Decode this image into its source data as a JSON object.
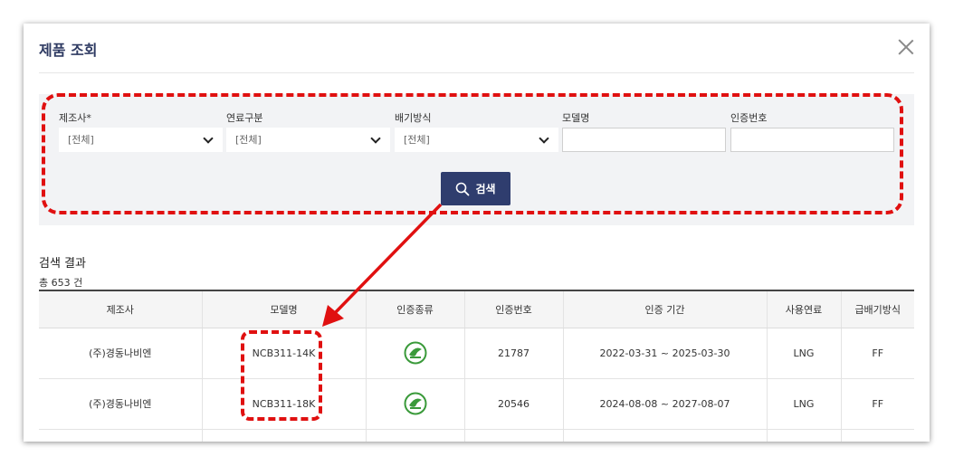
{
  "dialog": {
    "title": "제품 조회"
  },
  "filters": {
    "manufacturer": {
      "label": "제조사*",
      "value": "[전체]"
    },
    "fuel": {
      "label": "연료구분",
      "value": "[전체]"
    },
    "exhaust": {
      "label": "배기방식",
      "value": "[전체]"
    },
    "model": {
      "label": "모델명",
      "value": ""
    },
    "cert_no": {
      "label": "인증번호",
      "value": ""
    },
    "search_label": "검색"
  },
  "results": {
    "title": "검색 결과",
    "count": "총  653 건",
    "columns": [
      "제조사",
      "모델명",
      "인증종류",
      "인증번호",
      "인증 기간",
      "사용연료",
      "급배기방식"
    ],
    "rows": [
      {
        "maker": "(주)경동나비엔",
        "model": "NCB311-14K",
        "cert_type_icon": "eco-cert-icon",
        "cert_no": "21787",
        "period": "2022-03-31 ~ 2025-03-30",
        "fuel": "LNG",
        "exhaust": "FF"
      },
      {
        "maker": "(주)경동나비엔",
        "model": "NCB311-18K",
        "cert_type_icon": "eco-cert-icon",
        "cert_no": "20546",
        "period": "2024-08-08 ~ 2027-08-07",
        "fuel": "LNG",
        "exhaust": "FF"
      }
    ]
  },
  "colors": {
    "accent": "#2f3d6e",
    "highlight": "#e01010",
    "cert_green": "#3a9a3a"
  }
}
